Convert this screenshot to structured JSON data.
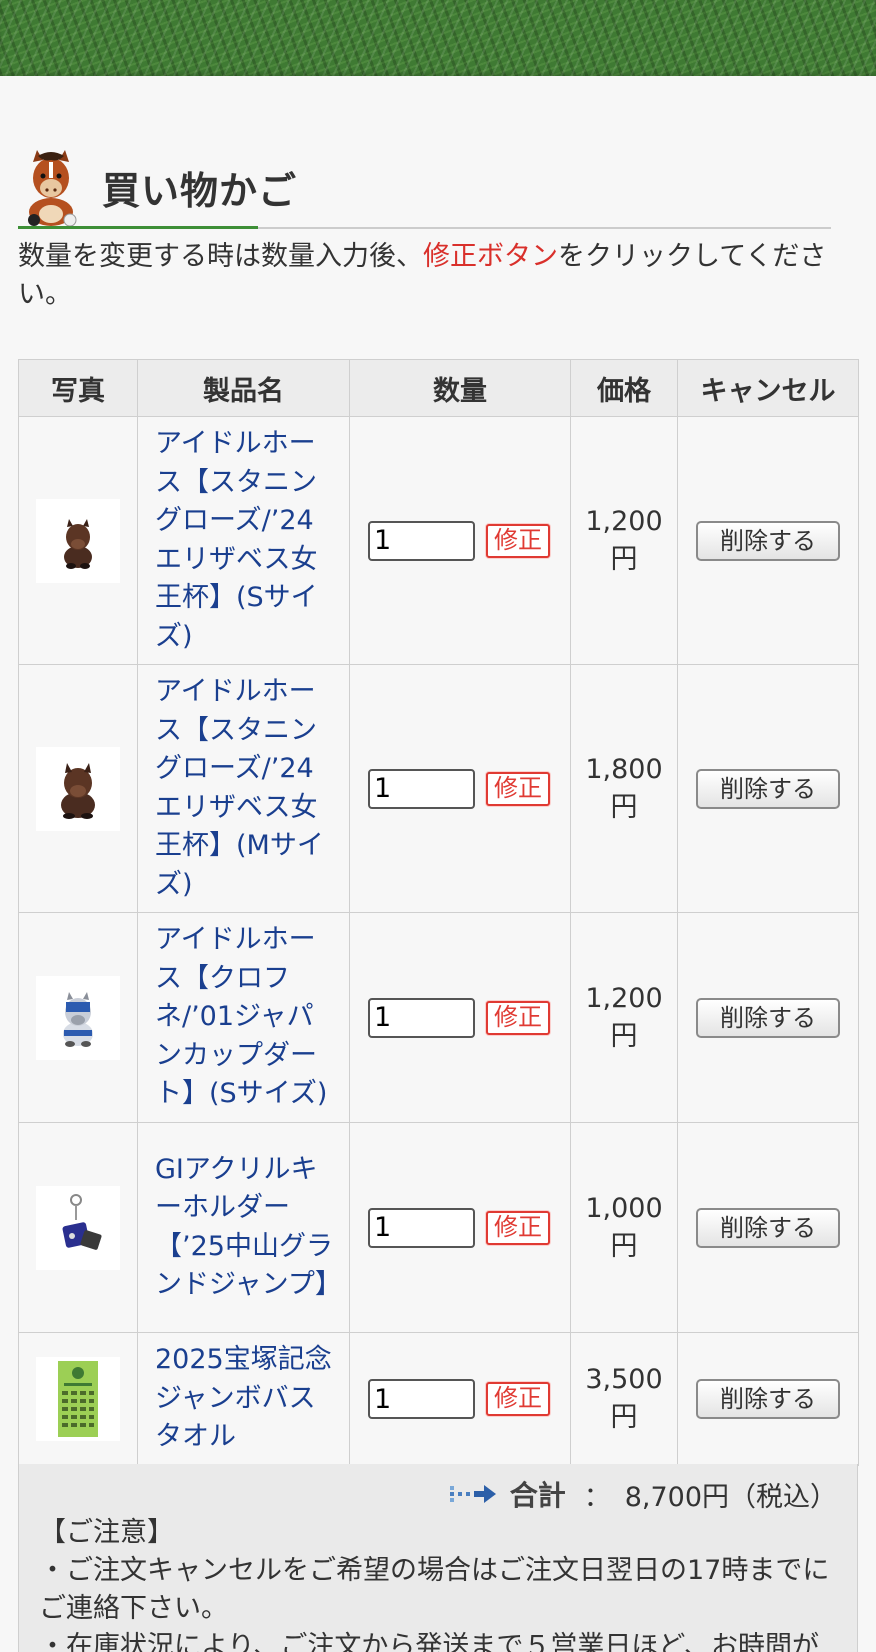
{
  "page": {
    "title": "買い物かご",
    "instruction_prefix": "数量を変更する時は数量入力後、",
    "instruction_highlight": "修正ボタン",
    "instruction_suffix": "をクリックしてください。"
  },
  "table": {
    "headers": {
      "photo": "写真",
      "name": "製品名",
      "qty": "数量",
      "price": "価格",
      "cancel": "キャンセル"
    },
    "fix_label": "修正",
    "delete_label": "削除する",
    "items": [
      {
        "name": "アイドルホース【スタニングローズ/’24エリザベス女王杯】(Sサイズ)",
        "qty": "1",
        "price": "1,200円",
        "thumb": "brown-horse-plush-icon"
      },
      {
        "name": "アイドルホース【スタニングローズ/’24エリザベス女王杯】(Mサイズ)",
        "qty": "1",
        "price": "1,800円",
        "thumb": "brown-horse-plush-icon"
      },
      {
        "name": "アイドルホース【クロフネ/’01ジャパンカップダート】(Sサイズ)",
        "qty": "1",
        "price": "1,200円",
        "thumb": "white-horse-plush-icon"
      },
      {
        "name": "GⅠアクリルキーホルダー【’25中山グランドジャンプ】",
        "qty": "1",
        "price": "1,000円",
        "thumb": "keyholder-icon"
      },
      {
        "name": "2025宝塚記念ジャンボバスタオル",
        "qty": "1",
        "price": "3,500円",
        "thumb": "towel-icon"
      }
    ]
  },
  "summary": {
    "total_label": "合計",
    "total_separator": "：",
    "total_value": "8,700円（税込）",
    "notes_heading": "【ご注意】",
    "notes": [
      "・ご注文キャンセルをご希望の場合はご注文日翌日の17時までにご連絡下さい。",
      "・在庫状況により、ご注文から発送まで５営業日ほど、お時間が"
    ]
  },
  "colors": {
    "accent_green": "#3d8f36",
    "link_blue": "#1a3f8f",
    "highlight_red": "#d9302b"
  }
}
